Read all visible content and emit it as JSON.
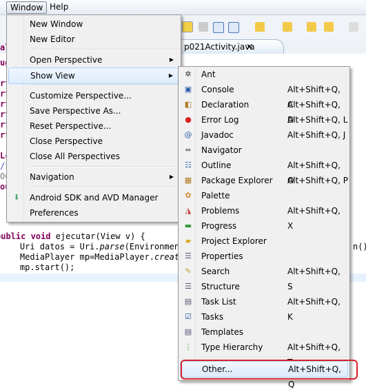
{
  "menubar": {
    "items": [
      "Window",
      "Help"
    ]
  },
  "editor": {
    "tab_label": "p021Activity.java",
    "left_fragments": [
      "al",
      "ug",
      "rt",
      "rt",
      "rt",
      "rt",
      "rt",
      "rt",
      "Lc",
      "/*",
      "OC",
      "ou"
    ],
    "code_lines": [
      [
        "public void ",
        "ejecutar(View v) {"
      ],
      [
        "    Uri datos = Uri.",
        "parse",
        "(Environment.",
        "n()"
      ],
      [
        "    MediaPlayer mp=MediaPlayer.",
        "create"
      ],
      [
        "    mp.start();"
      ]
    ]
  },
  "window_menu": {
    "items": [
      {
        "label": "New Window"
      },
      {
        "label": "New Editor"
      },
      {
        "label": "Open Perspective",
        "submenu": true
      },
      {
        "label": "Show View",
        "submenu": true,
        "highlighted": true
      },
      {
        "label": "Customize Perspective..."
      },
      {
        "label": "Save Perspective As..."
      },
      {
        "label": "Reset Perspective..."
      },
      {
        "label": "Close Perspective"
      },
      {
        "label": "Close All Perspectives"
      },
      {
        "label": "Navigation",
        "submenu": true
      },
      {
        "label": "Android SDK and AVD Manager",
        "icon": "android-sdk-icon"
      },
      {
        "label": "Preferences"
      }
    ]
  },
  "show_view_menu": {
    "items": [
      {
        "label": "Ant",
        "shortcut": "",
        "icon": "ant-icon"
      },
      {
        "label": "Console",
        "shortcut": "Alt+Shift+Q, C",
        "icon": "console-icon"
      },
      {
        "label": "Declaration",
        "shortcut": "Alt+Shift+Q, D",
        "icon": "declaration-icon"
      },
      {
        "label": "Error Log",
        "shortcut": "Alt+Shift+Q, L",
        "icon": "error-log-icon"
      },
      {
        "label": "Javadoc",
        "shortcut": "Alt+Shift+Q, J",
        "icon": "javadoc-icon"
      },
      {
        "label": "Navigator",
        "shortcut": "",
        "icon": "navigator-icon"
      },
      {
        "label": "Outline",
        "shortcut": "Alt+Shift+Q, O",
        "icon": "outline-icon"
      },
      {
        "label": "Package Explorer",
        "shortcut": "Alt+Shift+Q, P",
        "icon": "package-explorer-icon"
      },
      {
        "label": "Palette",
        "shortcut": "",
        "icon": "palette-icon"
      },
      {
        "label": "Problems",
        "shortcut": "Alt+Shift+Q, X",
        "icon": "problems-icon"
      },
      {
        "label": "Progress",
        "shortcut": "",
        "icon": "progress-icon"
      },
      {
        "label": "Project Explorer",
        "shortcut": "",
        "icon": "project-explorer-icon"
      },
      {
        "label": "Properties",
        "shortcut": "",
        "icon": "properties-icon"
      },
      {
        "label": "Search",
        "shortcut": "Alt+Shift+Q, S",
        "icon": "search-icon"
      },
      {
        "label": "Structure",
        "shortcut": "",
        "icon": "structure-icon"
      },
      {
        "label": "Task List",
        "shortcut": "Alt+Shift+Q, K",
        "icon": "task-list-icon"
      },
      {
        "label": "Tasks",
        "shortcut": "",
        "icon": "tasks-icon"
      },
      {
        "label": "Templates",
        "shortcut": "",
        "icon": "templates-icon"
      },
      {
        "label": "Type Hierarchy",
        "shortcut": "Alt+Shift+Q, T",
        "icon": "type-hierarchy-icon"
      },
      {
        "label": "Other...",
        "shortcut": "Alt+Shift+Q, Q",
        "highlighted": true,
        "annotated": true
      }
    ]
  },
  "colors": {
    "highlight_border": "#aecff7",
    "annotation": "#d9202a",
    "keyword": "#7f0055"
  }
}
